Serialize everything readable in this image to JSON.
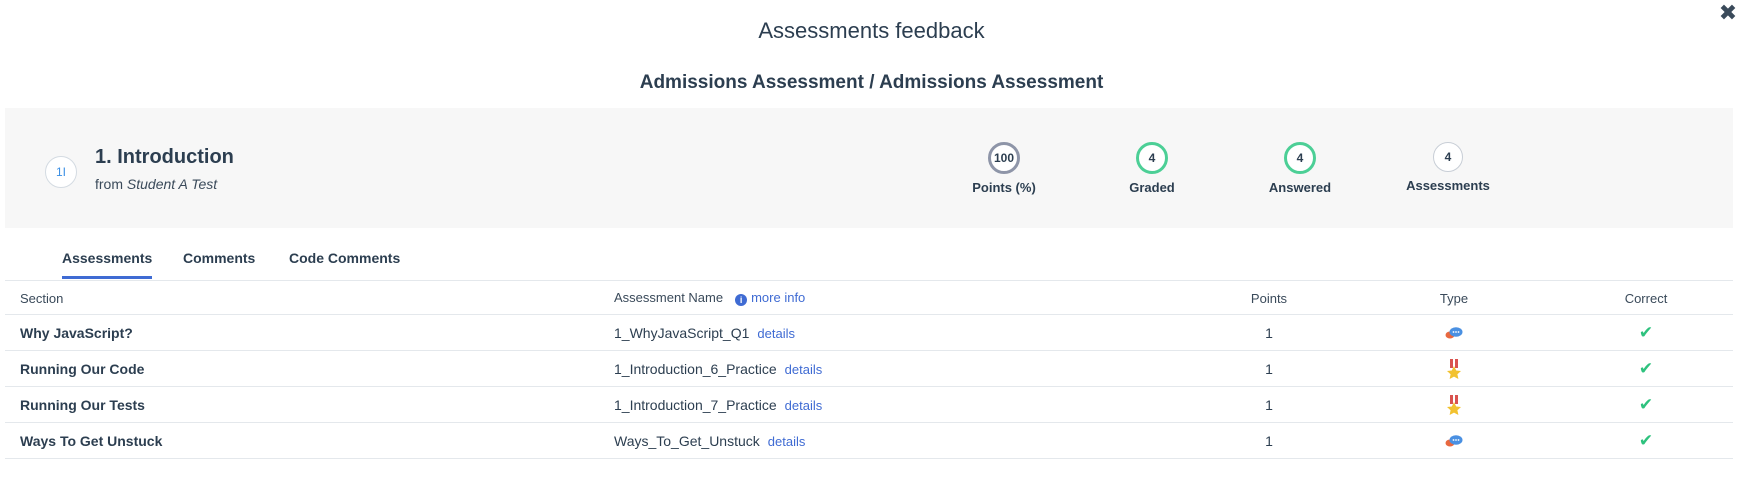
{
  "dialog": {
    "title": "Assessments feedback",
    "subtitle": "Admissions Assessment / Admissions Assessment",
    "close_glyph": "✖"
  },
  "summary": {
    "badge": "1I",
    "chapter_title": "1. Introduction",
    "from_prefix": "from",
    "from_name": "Student A Test",
    "stats": [
      {
        "value": "100",
        "label": "Points (%)"
      },
      {
        "value": "4",
        "label": "Graded"
      },
      {
        "value": "4",
        "label": "Answered"
      },
      {
        "value": "4",
        "label": "Assessments"
      }
    ]
  },
  "tabs": [
    {
      "label": "Assessments",
      "active": true
    },
    {
      "label": "Comments",
      "active": false
    },
    {
      "label": "Code Comments",
      "active": false
    }
  ],
  "table": {
    "headers": {
      "section": "Section",
      "assessment_name": "Assessment Name",
      "more_info": "more info",
      "points": "Points",
      "type": "Type",
      "correct": "Correct"
    },
    "details_label": "details",
    "rows": [
      {
        "section": "Why JavaScript?",
        "name": "1_WhyJavaScript_Q1",
        "points": "1",
        "type_icon": "chat-bubbles-icon",
        "correct": "✔"
      },
      {
        "section": "Running Our Code",
        "name": "1_Introduction_6_Practice",
        "points": "1",
        "type_icon": "medal-icon",
        "correct": "✔"
      },
      {
        "section": "Running Our Tests",
        "name": "1_Introduction_7_Practice",
        "points": "1",
        "type_icon": "medal-icon",
        "correct": "✔"
      },
      {
        "section": "Ways To Get Unstuck",
        "name": "Ways_To_Get_Unstuck",
        "points": "1",
        "type_icon": "chat-bubbles-icon",
        "correct": "✔"
      }
    ]
  },
  "colors": {
    "accent": "#3f6bd3",
    "success": "#2ec27e",
    "ring_green": "#4ccf96",
    "ring_grey": "#8e95a8"
  }
}
